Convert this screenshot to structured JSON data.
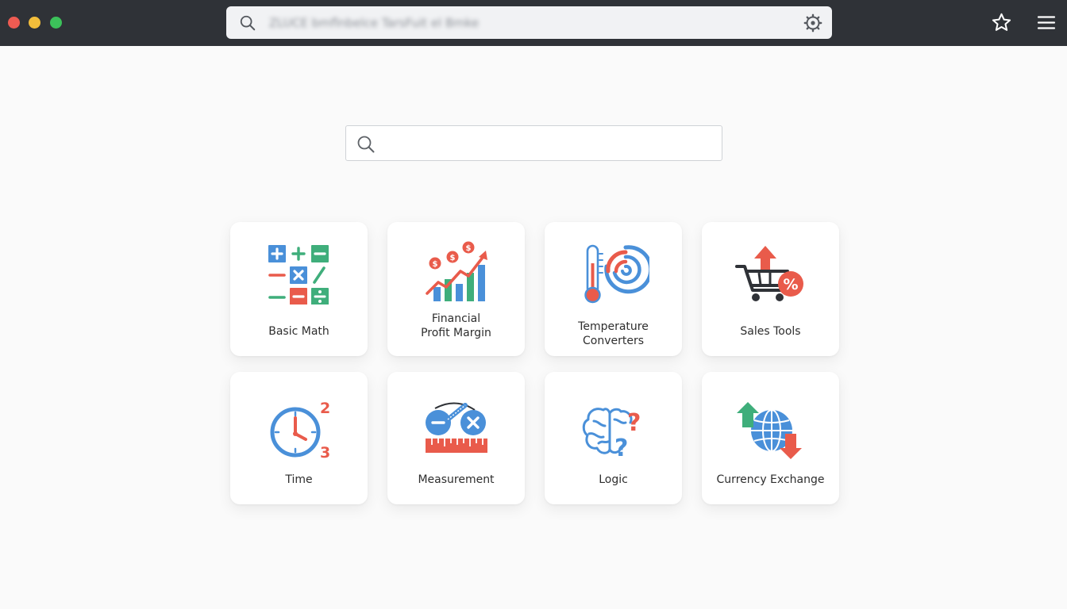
{
  "browser": {
    "url_text": "ZLUCE bmflnbelce TarsFuit el Bmke"
  },
  "search": {
    "placeholder": "",
    "value": ""
  },
  "categories": [
    {
      "label_line1": "Basic Math",
      "label_line2": "",
      "icon": "math-operators-icon"
    },
    {
      "label_line1": "Financial",
      "label_line2": "Profit Margin",
      "icon": "profit-chart-icon"
    },
    {
      "label_line1": "Temperature",
      "label_line2": "Converters",
      "icon": "thermometer-icon"
    },
    {
      "label_line1": "Sales Tools",
      "label_line2": "",
      "icon": "shopping-cart-percent-icon"
    },
    {
      "label_line1": "Time",
      "label_line2": "",
      "icon": "clock-icon"
    },
    {
      "label_line1": "Measurement",
      "label_line2": "",
      "icon": "ruler-icon"
    },
    {
      "label_line1": "Logic",
      "label_line2": "",
      "icon": "brain-question-icon"
    },
    {
      "label_line1": "Currency Exchange",
      "label_line2": "",
      "icon": "globe-exchange-icon"
    }
  ],
  "colors": {
    "chrome_bg": "#2f3237",
    "blue": "#4a90d9",
    "green": "#3fae7b",
    "red": "#e95b4b"
  }
}
